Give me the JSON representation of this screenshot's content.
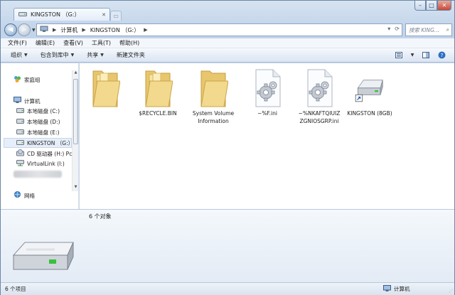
{
  "window": {
    "tab_title": "KINGSTON （G:）",
    "minimize": "–",
    "maximize": "□",
    "close": "✕"
  },
  "address": {
    "crumbs": [
      "计算机",
      "KINGSTON （G:）"
    ],
    "search_placeholder": "搜索 KING..."
  },
  "menu": [
    "文件(F)",
    "编辑(E)",
    "查看(V)",
    "工具(T)",
    "帮助(H)"
  ],
  "toolbar": {
    "organize": "组织",
    "include_in_library": "包含到库中",
    "share": "共享",
    "new_folder": "新建文件夹"
  },
  "nav": {
    "homegroup": "家庭组",
    "computer": "计算机",
    "drives": [
      "本地磁盘 (C:)",
      "本地磁盘 (D:)",
      "本地磁盘 (E:)",
      "KINGSTON （G:）",
      "CD 驱动器 (H:) Pc",
      "VirtualLink (I:)"
    ],
    "network": "网络"
  },
  "files": [
    {
      "name": "",
      "type": "folder"
    },
    {
      "name": "$RECYCLE.BIN",
      "type": "folder"
    },
    {
      "name": "System Volume Information",
      "type": "folder"
    },
    {
      "name": "~%F.ini",
      "type": "ini"
    },
    {
      "name": "~%NKAFTQIUIZ ZGNIOSGRP.ini",
      "type": "ini"
    },
    {
      "name": "KINGSTON (8GB)",
      "type": "drive"
    }
  ],
  "details": {
    "count_text": "6 个对象"
  },
  "status": {
    "items_text": "6 个项目",
    "location": "计算机"
  }
}
